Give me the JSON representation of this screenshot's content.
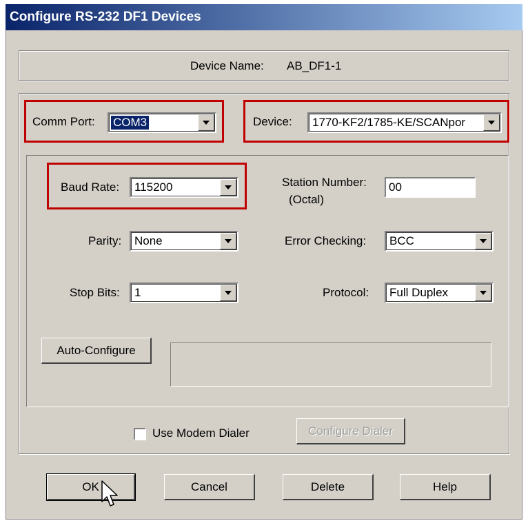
{
  "window": {
    "title": "Configure RS-232 DF1 Devices"
  },
  "device_name": {
    "label": "Device Name:",
    "value": "AB_DF1-1"
  },
  "comm_port": {
    "label": "Comm Port:",
    "value": "COM3"
  },
  "device": {
    "label": "Device:",
    "value": "1770-KF2/1785-KE/SCANpor"
  },
  "baud_rate": {
    "label": "Baud Rate:",
    "value": "115200"
  },
  "station_number": {
    "label_line1": "Station Number:",
    "label_line2": "(Octal)",
    "value": "00"
  },
  "parity": {
    "label": "Parity:",
    "value": "None"
  },
  "error_checking": {
    "label": "Error Checking:",
    "value": "BCC"
  },
  "stop_bits": {
    "label": "Stop Bits:",
    "value": "1"
  },
  "protocol": {
    "label": "Protocol:",
    "value": "Full Duplex"
  },
  "auto_configure": {
    "label": "Auto-Configure"
  },
  "modem": {
    "checkbox_label": "Use Modem Dialer",
    "checked": false,
    "configure_label": "Configure Dialer"
  },
  "buttons": {
    "ok": "OK",
    "cancel": "Cancel",
    "delete": "Delete",
    "help": "Help"
  },
  "colors": {
    "highlight": "#c00000",
    "title_bar": "#0a246a",
    "dialog_bg": "#d4d0c8"
  }
}
